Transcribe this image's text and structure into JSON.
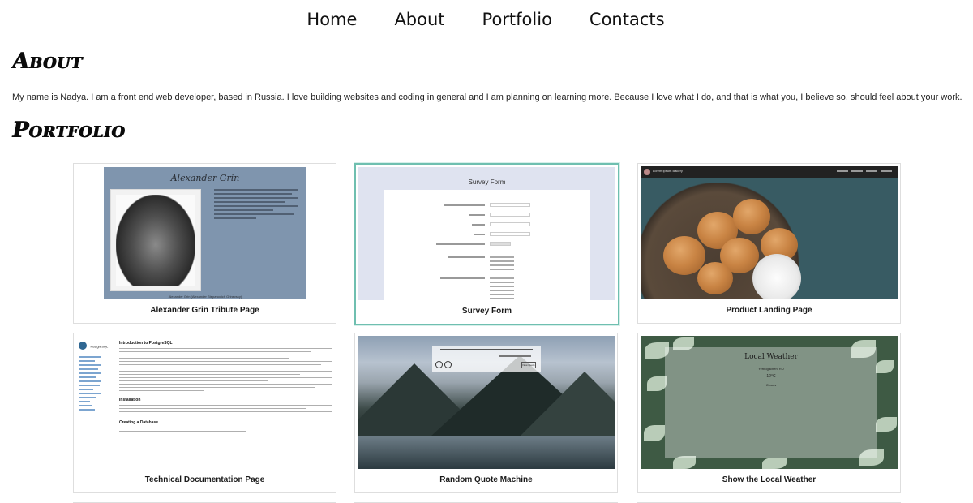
{
  "nav": {
    "items": [
      "Home",
      "About",
      "Portfolio",
      "Contacts"
    ]
  },
  "about": {
    "title": "About",
    "text": "My name is Nadya. I am a front end web developer, based in Russia. I love building websites and coding in general and I am planning on learning more. Because I love what I do, and that is what you, I believe so, should feel about your work."
  },
  "portfolio": {
    "title": "Portfolio",
    "projects": [
      {
        "label": "Alexander Grin Tribute Page",
        "thumb_title": "Alexander Grin",
        "thumb_caption": "Alexander Grin (Alexander Stepanovich Grinevsky)"
      },
      {
        "label": "Survey Form",
        "thumb_title": "Survey Form"
      },
      {
        "label": "Product Landing Page",
        "thumb_brand": "Lorem Ipsum Bakery",
        "thumb_nav": [
          "Home",
          "About",
          "Order",
          "Contact"
        ]
      },
      {
        "label": "Technical Documentation Page",
        "thumb_logo": "PostgreSQL",
        "thumb_headings": [
          "Introduction to PostgreSQL",
          "Installation",
          "Creating a Database"
        ]
      },
      {
        "label": "Random Quote Machine",
        "thumb_button": "New Quote"
      },
      {
        "label": "Show the Local Weather",
        "thumb_title": "Local Weather",
        "thumb_location": "Yerbogachen, RU",
        "thumb_temp": "12°C",
        "thumb_cond": "Clouds"
      }
    ]
  },
  "colors": {
    "active_border": "#6fbfb0",
    "tribute_bg": "#7f95ae",
    "survey_bg": "#dfe3f0"
  }
}
